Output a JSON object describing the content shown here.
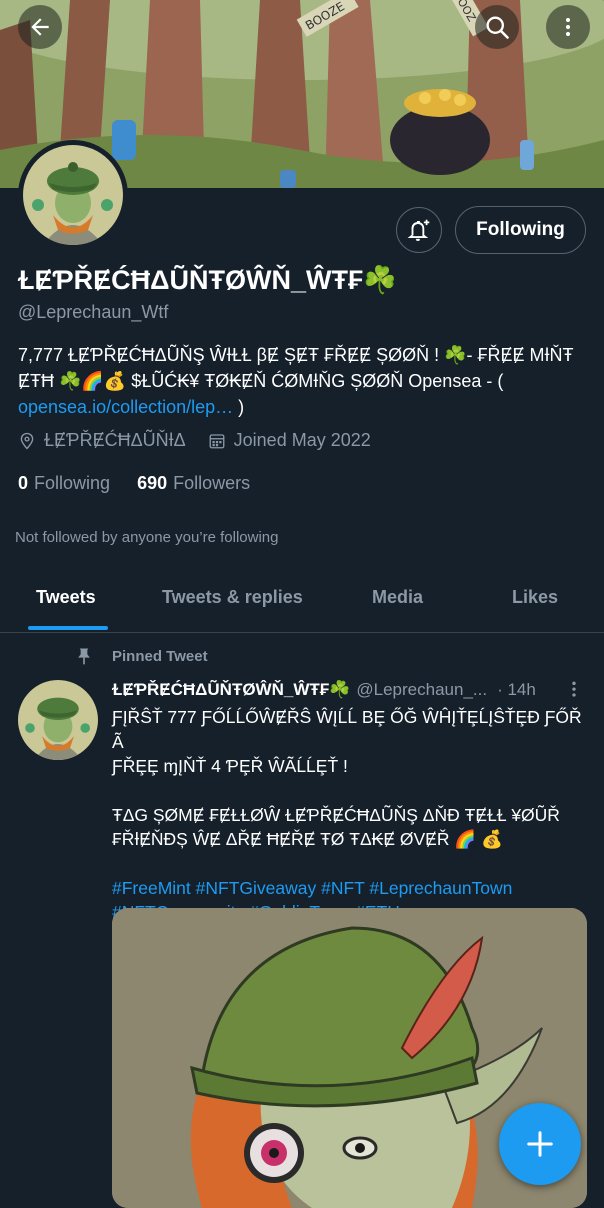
{
  "header": {
    "back_icon": "arrow-left-icon",
    "search_icon": "search-icon",
    "more_icon": "more-vertical-icon",
    "banner_sign_1": "BOOZE",
    "banner_sign_2": "BOOZ"
  },
  "profile": {
    "display_name": "ⱢɆƤŘɆĆĦΔŨŇŦØŴŇ_ŴŦ₣☘️",
    "handle": "@Leprechaun_Wtf",
    "bio_text": "7,777 ⱢɆƤŘɆĆĦΔŨŇŞ ŴƗⱢⱢ βɆ ȘɆŦ ₣ŘɆɆ ȘØØŇ ! ☘️- ₣ŘɆɆ MƗŇŦ ɆŦĦ ☘️🌈💰 $ⱢŨĆ₭¥ ŦØ₭ɆŇ ĆØMƗŇG ȘØØŇ  Opensea - ( ",
    "bio_link": "opensea.io/collection/lep…",
    "bio_close": " )",
    "location": "ⱢɆƤŘɆĆĦΔŨŇƗΔ",
    "joined": "Joined May 2022",
    "following_count": "0",
    "following_label": "Following",
    "followers_count": "690",
    "followers_label": "Followers",
    "not_followed": "Not followed by anyone you’re following",
    "following_button": "Following",
    "bell_icon": "bell-plus-icon",
    "location_icon": "location-pin-icon",
    "calendar_icon": "calendar-icon"
  },
  "tabs": [
    "Tweets",
    "Tweets & replies",
    "Media",
    "Likes"
  ],
  "tweet": {
    "pinned_label": "Pinned Tweet",
    "pin_icon": "pin-icon",
    "author_name": "ⱢɆƤŘɆĆĦΔŨŇŦØŴŇ_ŴŦ₣☘️",
    "author_handle": "@Leprechaun_...",
    "time": "· 14h",
    "line1": "ƑĮŘŜŤ 777 ƑŐĹĹŐŴɆŘŜ ŴĮĹĹ ΒȨ ŐĞ ŴĤĮŤȨĹĮŜŤȨĐ ƑŐŘ Ã",
    "line2": "ƑŘȨȨ ɱĮŇŤ 4 ƤȨŘ ŴÃĹĹȨŤ !",
    "line3": "ŦΔG ȘØMɆ ₣ɆⱢⱢØŴ ⱢɆƤŘɆĆĦΔŨŇŞ ΔŇĐ ŦɆⱢⱢ ¥ØŨŘ",
    "line4": "₣ŘƗɆŇĐȘ ŴɆ ΔŘɆ ĦɆŘɆ ŦØ ŦΔ₭Ɇ ØVɆŘ 🌈 💰",
    "tags1": "#FreeMint #NFTGiveaway #NFT #LeprechaunTown",
    "tags2": "#NFTCommunity  #GoblinTown #ETH"
  },
  "fab": {
    "icon": "plus-icon"
  }
}
